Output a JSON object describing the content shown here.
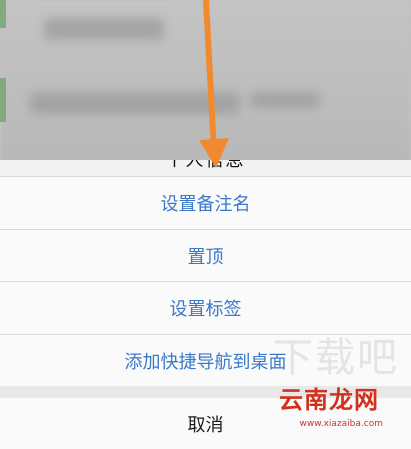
{
  "background": {
    "peek_text": "个人信息"
  },
  "action_sheet": {
    "items": [
      {
        "label": "设置备注名"
      },
      {
        "label": "置顶"
      },
      {
        "label": "设置标签"
      },
      {
        "label": "添加快捷导航到桌面"
      }
    ],
    "cancel_label": "取消"
  },
  "watermark": {
    "logo_text": "云南龙网",
    "url_text": "www.xiazaiba.com",
    "ghost_text": "下载吧"
  },
  "colors": {
    "link_blue": "#3b78c9",
    "arrow_orange": "#f18a2e",
    "watermark_red": "#d0321e"
  }
}
